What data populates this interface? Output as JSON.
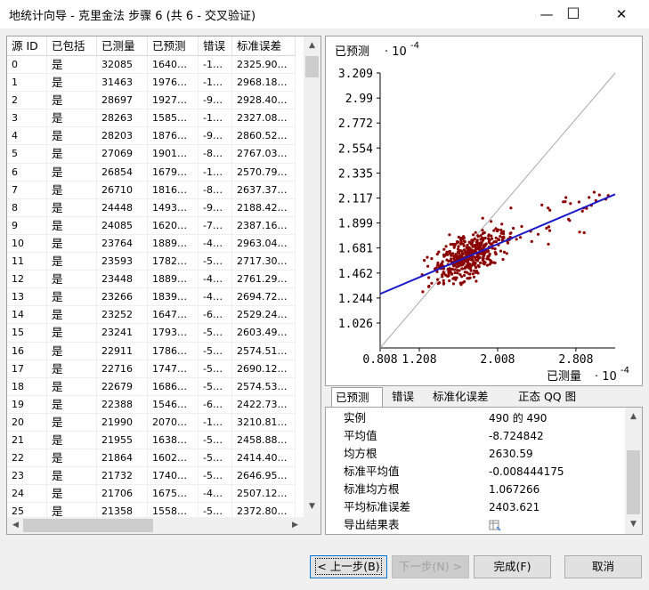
{
  "window": {
    "title": "地统计向导 - 克里金法 步骤 6 (共 6 - 交叉验证)",
    "min_symbol": "—",
    "max_symbol": "☐",
    "close_symbol": "✕"
  },
  "table": {
    "headers": [
      "源 ID",
      "已包括",
      "已测量",
      "已预测",
      "错误",
      "标准误差"
    ],
    "rows": [
      [
        "0",
        "是",
        "32085",
        "1640…",
        "-1…",
        "2325.90…"
      ],
      [
        "1",
        "是",
        "31463",
        "1976…",
        "-1…",
        "2968.18…"
      ],
      [
        "2",
        "是",
        "28697",
        "1927…",
        "-9…",
        "2928.40…"
      ],
      [
        "3",
        "是",
        "28263",
        "1585…",
        "-1…",
        "2327.08…"
      ],
      [
        "4",
        "是",
        "28203",
        "1876…",
        "-9…",
        "2860.52…"
      ],
      [
        "5",
        "是",
        "27069",
        "1901…",
        "-8…",
        "2767.03…"
      ],
      [
        "6",
        "是",
        "26854",
        "1679…",
        "-1…",
        "2570.79…"
      ],
      [
        "7",
        "是",
        "26710",
        "1816…",
        "-8…",
        "2637.37…"
      ],
      [
        "8",
        "是",
        "24448",
        "1493…",
        "-9…",
        "2188.42…"
      ],
      [
        "9",
        "是",
        "24085",
        "1620…",
        "-7…",
        "2387.16…"
      ],
      [
        "10",
        "是",
        "23764",
        "1889…",
        "-4…",
        "2963.04…"
      ],
      [
        "11",
        "是",
        "23593",
        "1782…",
        "-5…",
        "2717.30…"
      ],
      [
        "12",
        "是",
        "23448",
        "1889…",
        "-4…",
        "2761.29…"
      ],
      [
        "13",
        "是",
        "23266",
        "1839…",
        "-4…",
        "2694.72…"
      ],
      [
        "14",
        "是",
        "23252",
        "1647…",
        "-6…",
        "2529.24…"
      ],
      [
        "15",
        "是",
        "23241",
        "1793…",
        "-5…",
        "2603.49…"
      ],
      [
        "16",
        "是",
        "22911",
        "1786…",
        "-5…",
        "2574.51…"
      ],
      [
        "17",
        "是",
        "22716",
        "1747…",
        "-5…",
        "2690.12…"
      ],
      [
        "18",
        "是",
        "22679",
        "1686…",
        "-5…",
        "2574.53…"
      ],
      [
        "19",
        "是",
        "22388",
        "1546…",
        "-6…",
        "2422.73…"
      ],
      [
        "20",
        "是",
        "21990",
        "2070…",
        "-1…",
        "3210.81…"
      ],
      [
        "21",
        "是",
        "21955",
        "1638…",
        "-5…",
        "2458.88…"
      ],
      [
        "22",
        "是",
        "21864",
        "1602…",
        "-5…",
        "2414.40…"
      ],
      [
        "23",
        "是",
        "21732",
        "1740…",
        "-5…",
        "2646.95…"
      ],
      [
        "24",
        "是",
        "21706",
        "1675…",
        "-4…",
        "2507.12…"
      ],
      [
        "25",
        "是",
        "21358",
        "1558…",
        "-5…",
        "2372.80…"
      ]
    ]
  },
  "chart_data": {
    "type": "scatter",
    "ylabel": "已预测",
    "ylabel_exp": "· 10",
    "xlabel": "已测量",
    "xlabel_exp": "· 10",
    "exponent": "-4",
    "x_ticks": [
      "0.808",
      "1.208",
      "2.008",
      "2.808"
    ],
    "x_tick_values": [
      0.808,
      1.208,
      2.008,
      2.808
    ],
    "y_ticks": [
      "3.209",
      "2.99",
      "2.772",
      "2.554",
      "2.335",
      "2.117",
      "1.899",
      "1.681",
      "1.462",
      "1.244",
      "1.026"
    ],
    "y_tick_values": [
      3.209,
      2.99,
      2.772,
      2.554,
      2.335,
      2.117,
      1.899,
      1.681,
      1.462,
      1.244,
      1.026
    ],
    "xlim": [
      0.808,
      3.209
    ],
    "ylim": [
      0.808,
      3.209
    ],
    "regression_line": {
      "x1": 0.808,
      "y1": 1.28,
      "x2": 3.209,
      "y2": 2.15
    },
    "reference_line": "y = x",
    "point_color": "#8b0000",
    "line_color": "#1a1ac8",
    "reference_color": "#a8a8a8",
    "point_count": 490
  },
  "tabs": [
    "已预测",
    "错误",
    "标准化误差",
    "正态 QQ 图"
  ],
  "stats": {
    "rows": [
      {
        "label": "实例",
        "value": "490 的 490"
      },
      {
        "label": "平均值",
        "value": "-8.724842"
      },
      {
        "label": "均方根",
        "value": "2630.59"
      },
      {
        "label": "标准平均值",
        "value": "-0.008444175"
      },
      {
        "label": "标准均方根",
        "value": "1.067266"
      },
      {
        "label": "平均标准误差",
        "value": "2403.621"
      },
      {
        "label": "导出结果表",
        "value": ""
      }
    ]
  },
  "buttons": {
    "back": "< 上一步(B)",
    "next": "下一步(N) >",
    "finish": "完成(F)",
    "cancel": "取消"
  }
}
